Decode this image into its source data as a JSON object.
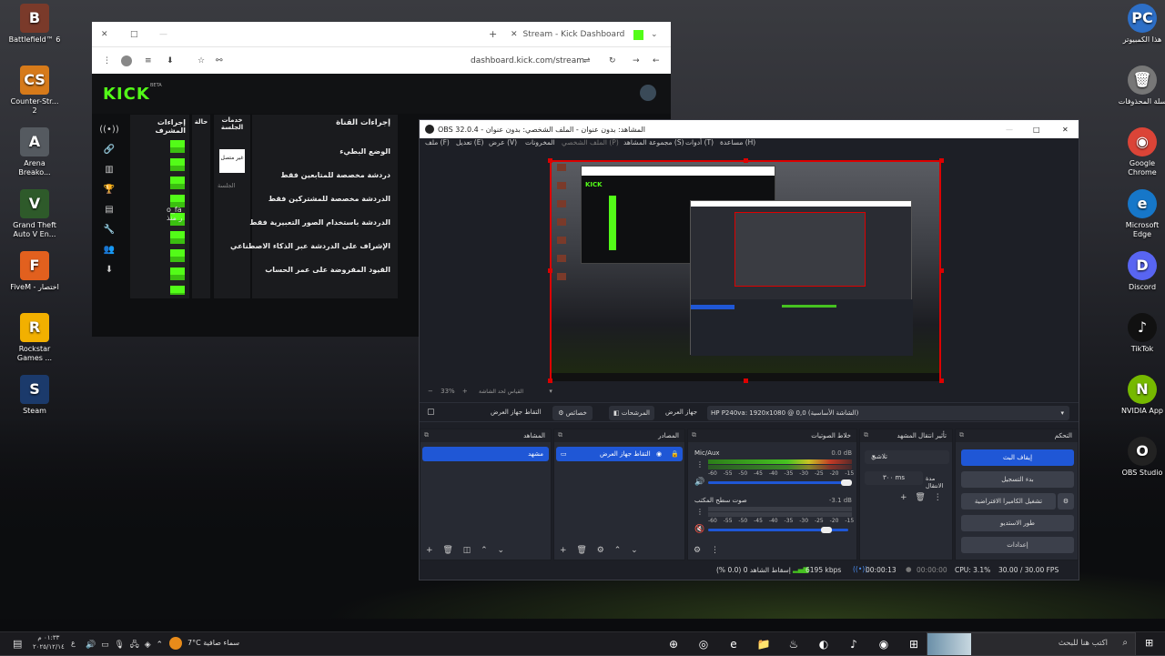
{
  "desktop_left": [
    {
      "label": "Battlefield™ 6",
      "glyph": "B",
      "color": "#7a3a2a"
    },
    {
      "label": "Counter-Str... 2",
      "glyph": "CS",
      "color": "#d67a1a"
    },
    {
      "label": "Arena Breako...",
      "glyph": "A",
      "color": "#555a60"
    },
    {
      "label": "Grand Theft Auto V En...",
      "glyph": "V",
      "color": "#2e5a2a"
    },
    {
      "label": "FiveM - اختصار",
      "glyph": "F",
      "color": "#e2601e"
    },
    {
      "label": "Rockstar Games ...",
      "glyph": "R",
      "color": "#f2b000"
    },
    {
      "label": "Steam",
      "glyph": "S",
      "color": "#1b3a6b"
    }
  ],
  "desktop_right": [
    {
      "label": "هذا الكمبيوتر",
      "glyph": "PC",
      "color": "#2d6fc7"
    },
    {
      "label": "سلة المحذوفات",
      "glyph": "🗑",
      "color": "#777"
    },
    {
      "label": "Google Chrome",
      "glyph": "◉",
      "color": "#db4437"
    },
    {
      "label": "Microsoft Edge",
      "glyph": "e",
      "color": "#1677c9"
    },
    {
      "label": "Discord",
      "glyph": "D",
      "color": "#5865f2"
    },
    {
      "label": "TikTok",
      "glyph": "♪",
      "color": "#111"
    },
    {
      "label": "NVIDIA App",
      "glyph": "N",
      "color": "#76b900"
    },
    {
      "label": "OBS Studio",
      "glyph": "O",
      "color": "#222"
    }
  ],
  "browser": {
    "tab_title": "Stream - Kick Dashboard",
    "url": "dashboard.kick.com/stream",
    "kick_logo": "KICK",
    "kick_beta": "BETA",
    "sidebar_glyphs": [
      "((•))",
      "🔗",
      "▥",
      "🏆",
      "▤",
      "🔧",
      "👥",
      "⬇"
    ],
    "panel_headers": [
      "إجراءات المشرف",
      "حالة",
      "خدمات الجلسة",
      "إجراءات القناة"
    ],
    "session_label": "غير متصل",
    "session_sub": "الجلسة",
    "channel_actions": [
      "الوضع البطيء",
      "دردشة مخصصة للمتابعين فقط",
      "الدردشة مخصصة للمشتركين فقط",
      "الدردشة باستخدام الصور التعبيرية فقط",
      "الإشراف على الدردشة عبر الذكاء الاصطناعي",
      "القيود المفروضة على عمر الحساب"
    ],
    "partial_text": "o_fa\nر منذ"
  },
  "obs": {
    "title": "OBS 32.0.4 - المشاهد: بدون عنوان - الملف الشخصي: بدون عنوان",
    "menu": [
      "ملف (F)",
      "تعديل (E)",
      "عرض (V)",
      "الملف الشخصي (P)",
      "مجموعة المشاهد (S)",
      "أدوات (T)",
      "مساعدة (H)"
    ],
    "docks_label": "المخرونات",
    "zoom": "33%",
    "preview_hint": "القياس لحد الشاشة",
    "source_bar": {
      "display": "HP P240va: 1920x1080 @ 0,0 (الشاشة الأساسية)",
      "device_label": "جهاز العرض",
      "filters": "المرشحات",
      "properties": "خصائص",
      "capture_label": "التقاط جهاز العرض"
    },
    "scenes": {
      "title": "المشاهد",
      "items": [
        "مشهد"
      ]
    },
    "sources": {
      "title": "المصادر",
      "items": [
        "التقاط جهاز العرض"
      ]
    },
    "mixer": {
      "title": "خلاط الصوتيات",
      "channels": [
        {
          "name": "Mic/Aux",
          "db": "0.0 dB",
          "level": 0.72
        },
        {
          "name": "صوت سطح المكتب",
          "db": "-3.1 dB",
          "level": 0.0
        }
      ],
      "scale": "-60 -55 -50 -45 -40 -35 -30 -25 -20 -15 -10 -5 0"
    },
    "transitions": {
      "title": "تأثير انتقال المشهد",
      "type": "تلاشي",
      "duration_label": "مدة الانتقال",
      "duration": "٣٠٠ ms"
    },
    "controls": {
      "title": "التحكم",
      "stop_stream": "إيقاف البث",
      "start_recording": "بدء التسجيل",
      "virtual_cam": "تشغيل الكاميرا الافتراضية",
      "studio_mode": "طور الاستديو",
      "settings": "إعدادات"
    },
    "status": {
      "dropped": "إسقاط الشاهد 0 (0.0 %)",
      "bitrate": "6195 kbps",
      "stream_time": "00:00:13",
      "rec_time": "00:00:00",
      "cpu": "CPU: 3.1%",
      "fps": "30.00 / 30.00 FPS"
    }
  },
  "taskbar": {
    "search_placeholder": "اكتب هنا للبحث",
    "weather": "7°C سماء صافية",
    "time": "٠١:٣٣ م",
    "date": "٢٠٢٥/١٢/١٤",
    "lang": "ع",
    "apps": [
      "⊕",
      "◎",
      "e",
      "📁",
      "♨",
      "◐",
      "♪",
      "◉",
      "⊞"
    ]
  }
}
